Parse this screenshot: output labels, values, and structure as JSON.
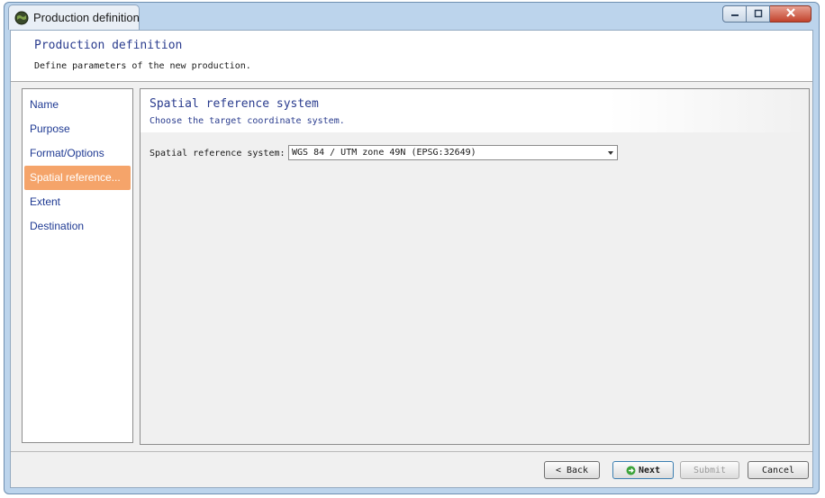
{
  "window": {
    "title": "Production definition"
  },
  "header": {
    "title": "Production definition",
    "subtitle": "Define parameters of the new production."
  },
  "sidebar": {
    "items": [
      {
        "label": "Name"
      },
      {
        "label": "Purpose"
      },
      {
        "label": "Format/Options"
      },
      {
        "label": "Spatial reference..."
      },
      {
        "label": "Extent"
      },
      {
        "label": "Destination"
      }
    ],
    "active_index": 3
  },
  "content": {
    "title": "Spatial reference system",
    "subtitle": "Choose the target coordinate system.",
    "field_label": "Spatial reference system:",
    "selected_value": "WGS 84 / UTM zone 49N (EPSG:32649)"
  },
  "footer": {
    "back_label": "< Back",
    "next_label": "Next",
    "submit_label": "Submit",
    "cancel_label": "Cancel"
  },
  "colors": {
    "accent_active": "#f5a46a",
    "title_blue": "#2a3c8e",
    "close_red": "#c2432c"
  },
  "icons": {
    "app": "globe-icon",
    "next": "next-arrow-icon",
    "minimize": "minimize-icon",
    "maximize": "maximize-icon",
    "close": "close-icon"
  }
}
